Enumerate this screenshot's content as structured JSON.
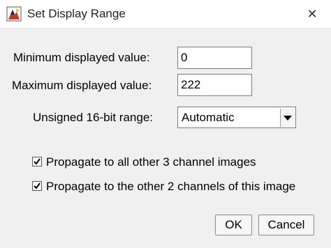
{
  "window": {
    "title": "Set Display Range",
    "app_icon": "imagej-icon",
    "close_glyph": "✕"
  },
  "fields": {
    "min_label": "Minimum displayed value:",
    "min_value": "0",
    "max_label": "Maximum displayed value:",
    "max_value": "222"
  },
  "range": {
    "label": "Unsigned 16-bit range:",
    "selected": "Automatic"
  },
  "options": {
    "propagate_all_label": "Propagate to all other 3 channel images",
    "propagate_all_checked": true,
    "propagate_channels_label": "Propagate to the other 2 channels of this image",
    "propagate_channels_checked": true
  },
  "buttons": {
    "ok": "OK",
    "cancel": "Cancel"
  },
  "colors": {
    "dialog_bg": "#f0f0f0",
    "titlebar_bg": "#ffffff"
  }
}
